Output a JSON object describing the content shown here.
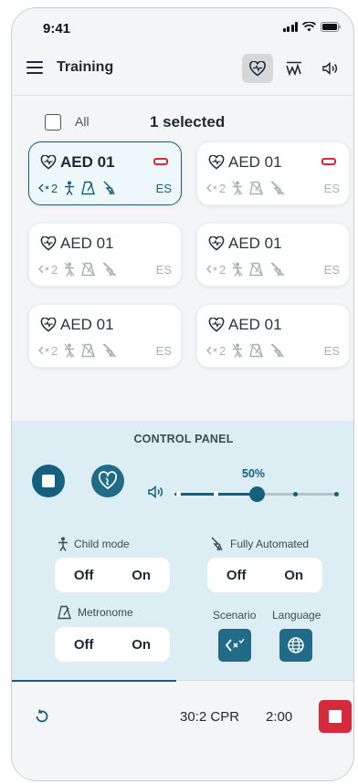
{
  "status_bar": {
    "time": "9:41"
  },
  "app_bar": {
    "title": "Training",
    "actions": [
      {
        "icon": "heart-pulse-icon",
        "active": true
      },
      {
        "icon": "wave-monitor-icon",
        "active": false
      },
      {
        "icon": "speaker-icon",
        "active": false
      }
    ]
  },
  "selection": {
    "all_label": "All",
    "selected_text": "1 selected",
    "all_checked": false
  },
  "devices": [
    {
      "name": "AED 01",
      "ratio": "2",
      "lang": "ES",
      "selected": true,
      "battery_alert": true
    },
    {
      "name": "AED 01",
      "ratio": "2",
      "lang": "ES",
      "selected": false,
      "battery_alert": true
    },
    {
      "name": "AED 01",
      "ratio": "2",
      "lang": "ES",
      "selected": false,
      "battery_alert": false
    },
    {
      "name": "AED 01",
      "ratio": "2",
      "lang": "ES",
      "selected": false,
      "battery_alert": false
    },
    {
      "name": "AED 01",
      "ratio": "2",
      "lang": "ES",
      "selected": false,
      "battery_alert": false
    },
    {
      "name": "AED 01",
      "ratio": "2",
      "lang": "ES",
      "selected": false,
      "battery_alert": false
    }
  ],
  "control_panel": {
    "title": "CONTROL PANEL",
    "volume": {
      "value_label": "50%",
      "level": 0.5
    },
    "child_mode": {
      "label": "Child mode",
      "off": "Off",
      "on": "On"
    },
    "fully_automated": {
      "label": "Fully Automated",
      "off": "Off",
      "on": "On"
    },
    "metronome": {
      "label": "Metronome",
      "off": "Off",
      "on": "On"
    },
    "scenario": {
      "label": "Scenario"
    },
    "language": {
      "label": "Language"
    }
  },
  "bottom_bar": {
    "mode": "30:2 CPR",
    "timer": "2:00",
    "progress": 0.48
  },
  "colors": {
    "accent": "#15607e",
    "alert": "#d62a3c",
    "panel": "#dcedf3"
  }
}
